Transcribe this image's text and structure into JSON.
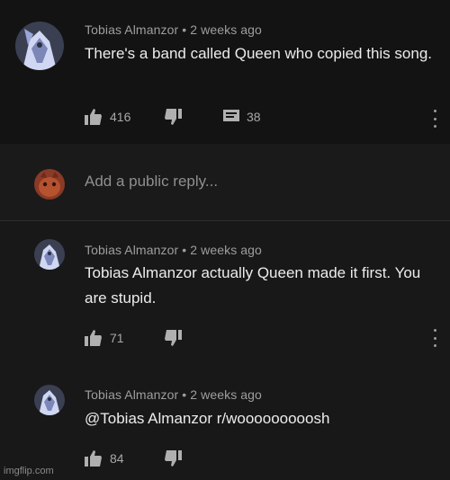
{
  "comments": [
    {
      "author": "Tobias Almanzor",
      "time": "2 weeks ago",
      "text": "There's a band called Queen who copied this song.",
      "likes": "416",
      "replies": "38"
    },
    {
      "author": "Tobias Almanzor",
      "time": "2 weeks ago",
      "text": "Tobias Almanzor actually Queen made it first. You are stupid.",
      "likes": "71"
    },
    {
      "author": "Tobias Almanzor",
      "time": "2 weeks ago",
      "text": "@Tobias Almanzor r/wooooooooosh",
      "likes": "84"
    }
  ],
  "reply": {
    "placeholder": "Add a public reply..."
  },
  "watermark": "imgflip.com",
  "icons": {
    "like": "thumbs-up-icon",
    "dislike": "thumbs-down-icon",
    "replies": "comment-icon",
    "menu": "more-vertical-icon"
  },
  "colors": {
    "background": "#181818",
    "text": "#ececec",
    "meta": "#9e9e9e"
  }
}
